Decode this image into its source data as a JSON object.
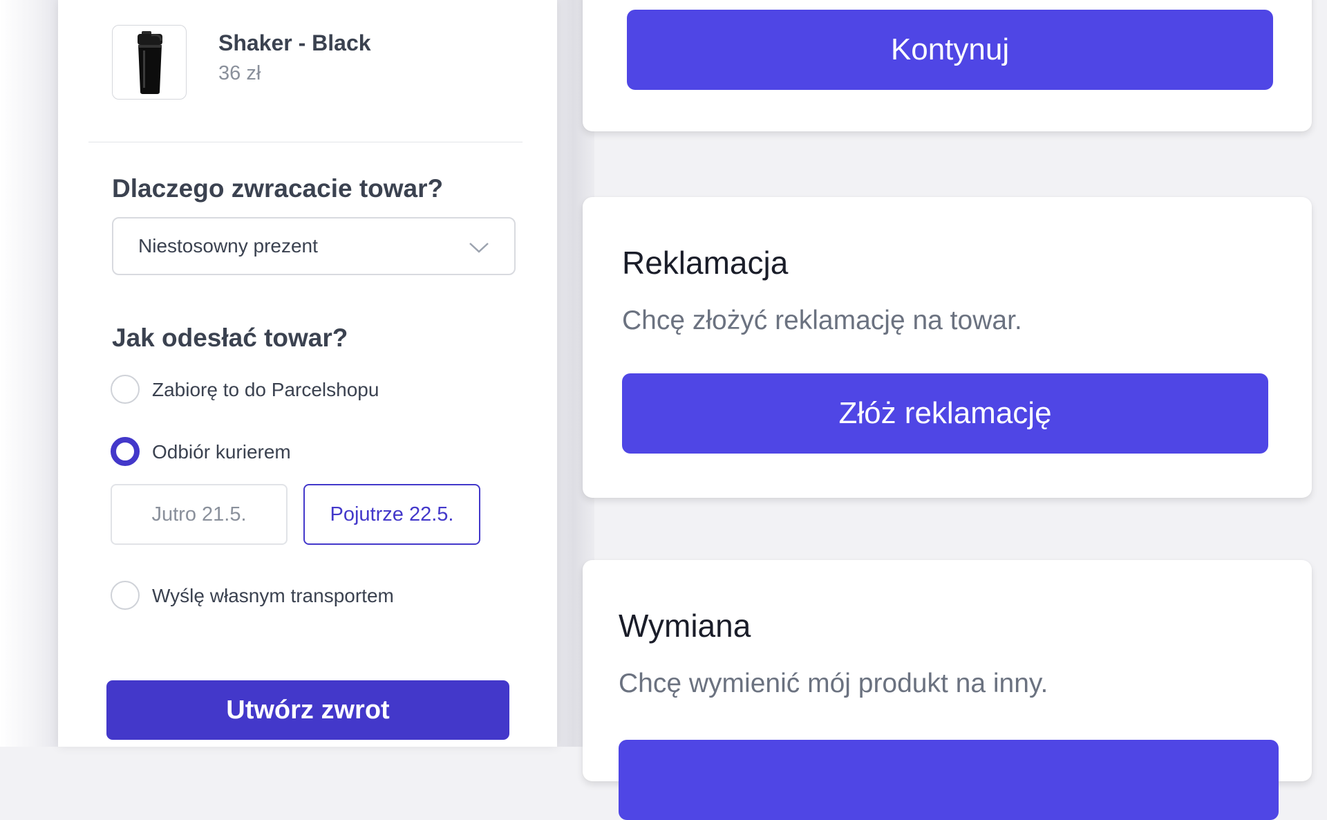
{
  "product": {
    "name": "Shaker - Black",
    "price": "36 zł",
    "thumb_icon": "shaker-bottle-icon"
  },
  "return_form": {
    "reason_question": "Dlaczego zwracacie towar?",
    "reason_selected": "Niestosowny prezent",
    "shipping_question": "Jak odesłać towar?",
    "options": [
      {
        "label": "Zabiorę to do Parcelshopu",
        "checked": false
      },
      {
        "label": "Odbiór kurierem",
        "checked": true
      },
      {
        "label": "Wyślę własnym transportem",
        "checked": false
      }
    ],
    "dates": [
      {
        "label": "Jutro 21.5.",
        "selected": false
      },
      {
        "label": "Pojutrze 22.5.",
        "selected": true
      }
    ],
    "submit_label": "Utwórz zwrot"
  },
  "cards": {
    "continue_label": "Kontynuj",
    "complaint": {
      "title": "Reklamacja",
      "description": "Chcę złożyć reklamację na towar.",
      "button_label": "Złóż reklamację"
    },
    "exchange": {
      "title": "Wymiana",
      "description": "Chcę wymienić mój produkt na inny.",
      "button_label": ""
    }
  },
  "colors": {
    "primary_dark": "#4338ca",
    "primary": "#4f46e5",
    "text": "#3b4250",
    "muted": "#8a909b"
  }
}
